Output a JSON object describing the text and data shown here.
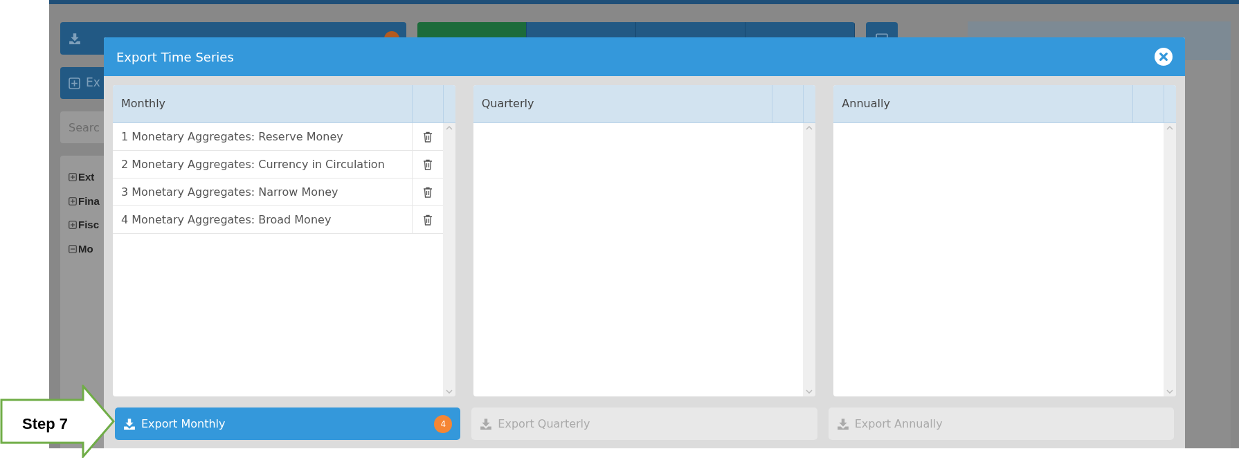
{
  "background": {
    "add_button": {
      "label": "Ex"
    },
    "search": {
      "placeholder": "Searc"
    },
    "tree": [
      {
        "label": "Ext",
        "expanded": false
      },
      {
        "label": "Fina",
        "expanded": false
      },
      {
        "label": "Fisc",
        "expanded": false
      },
      {
        "label": "Mo",
        "expanded": true
      }
    ],
    "tabs": [
      {
        "selected": true
      },
      {
        "selected": false
      },
      {
        "selected": false
      },
      {
        "selected": false
      }
    ]
  },
  "dialog": {
    "title": "Export Time Series",
    "panels": [
      {
        "title": "Monthly",
        "items": [
          "1 Monetary Aggregates: Reserve Money",
          "2 Monetary Aggregates: Currency in Circulation",
          "3 Monetary Aggregates: Narrow Money",
          "4 Monetary Aggregates: Broad Money"
        ]
      },
      {
        "title": "Quarterly"
      },
      {
        "title": "Annually"
      }
    ],
    "buttons": [
      {
        "label": "Export Monthly",
        "disabled": false,
        "count": "4"
      },
      {
        "label": "Export Quarterly",
        "disabled": true
      },
      {
        "label": "Export Annually",
        "disabled": true
      }
    ]
  },
  "callout": {
    "label": "Step 7"
  }
}
